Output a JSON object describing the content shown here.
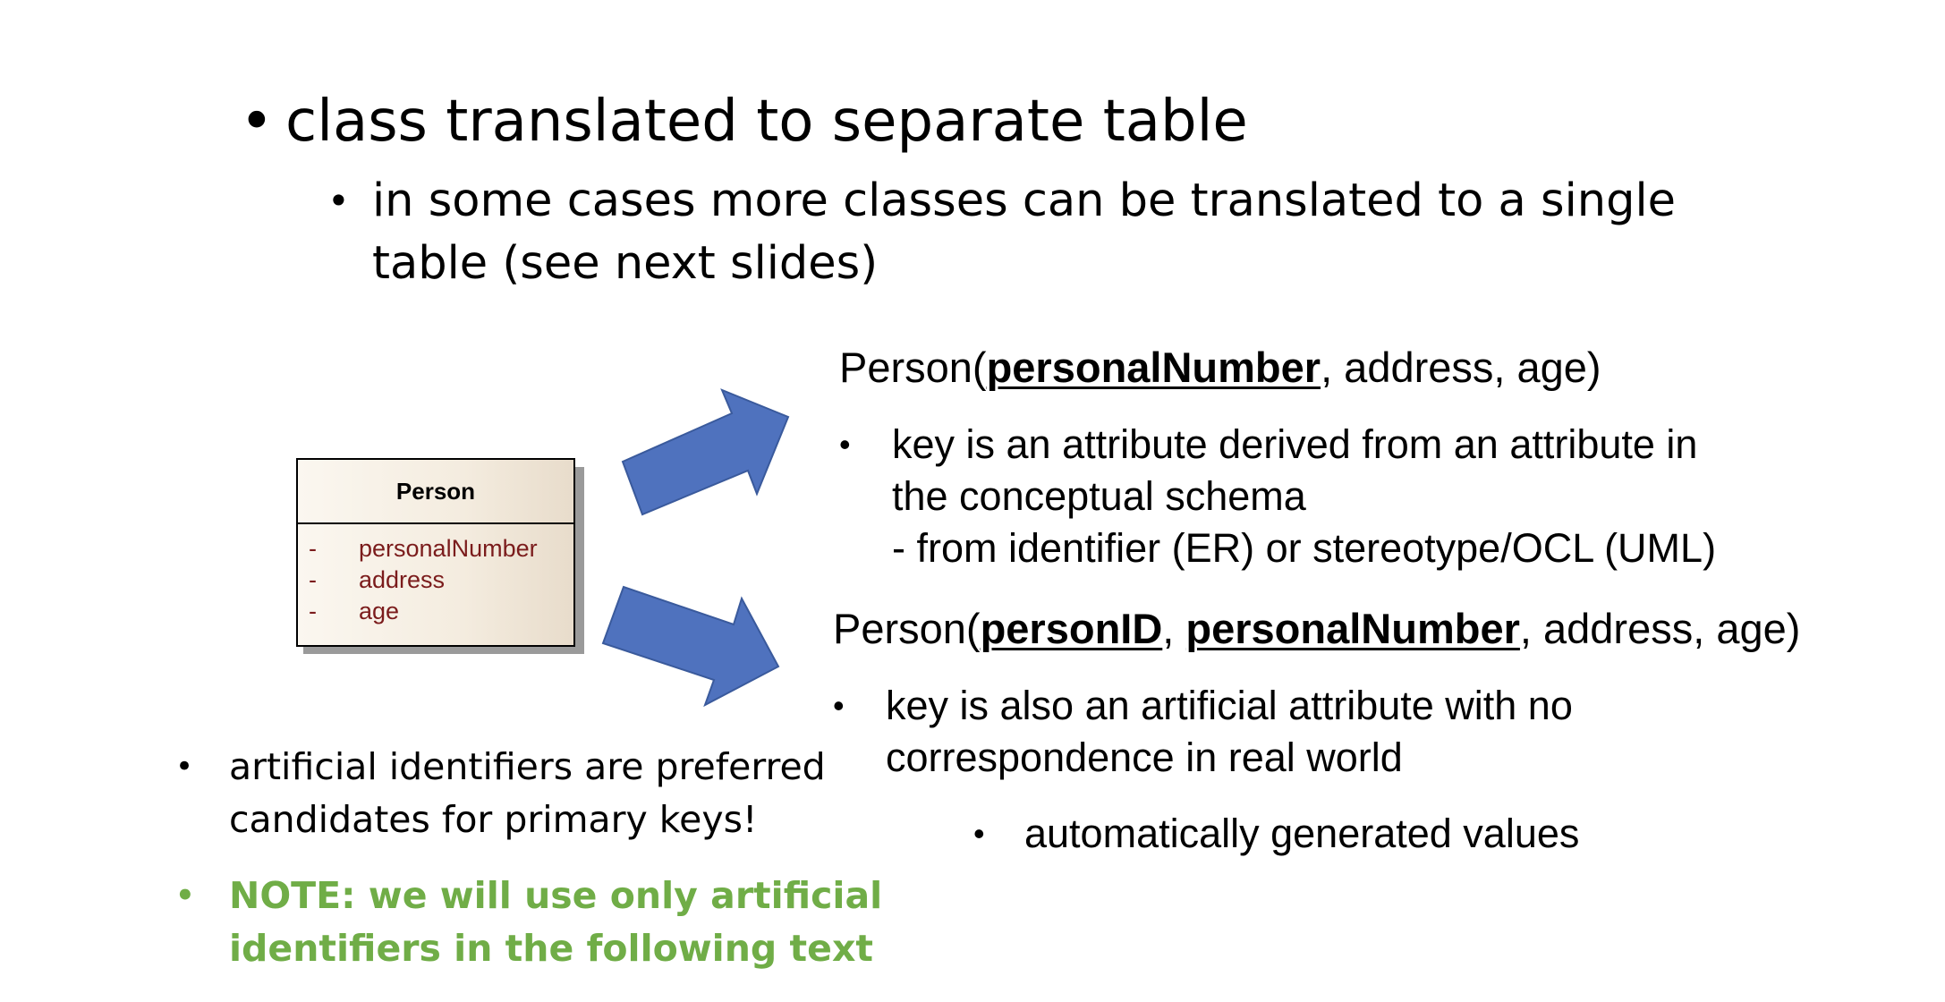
{
  "bullets": {
    "main": "class translated to separate table",
    "sub_line1": "in some cases more classes can be translated to a single",
    "sub_line2": "table (see next slides)",
    "bullet_char": "•"
  },
  "uml": {
    "class_name": "Person",
    "attributes": [
      {
        "visibility": "-",
        "name": "personalNumber"
      },
      {
        "visibility": "-",
        "name": "address"
      },
      {
        "visibility": "-",
        "name": "age"
      }
    ]
  },
  "option1": {
    "prefix": "Person(",
    "key": "personalNumber",
    "rest": ", address, age)",
    "desc_line1": "key is an attribute derived from an attribute in",
    "desc_line2": "the conceptual schema",
    "desc_line3": "- from identifier (ER) or stereotype/OCL (UML)"
  },
  "option2": {
    "prefix": "Person(",
    "key1": "personID",
    "sep": ", ",
    "key2": "personalNumber",
    "rest": ", address, age)",
    "desc_line1": "key is also an artificial attribute with no",
    "desc_line2": "correspondence in real world",
    "sub_desc": "automatically generated values"
  },
  "notes": {
    "line1": "artificial identifiers are preferred",
    "line2": "candidates for primary keys!",
    "note_line1": "NOTE: we will use only artificial",
    "note_line2": "identifiers in the following text"
  },
  "colors": {
    "arrow_fill": "#4f72be",
    "arrow_stroke": "#3a5a9c",
    "note_green": "#70ad47",
    "attr_red": "#7b1c1c"
  }
}
